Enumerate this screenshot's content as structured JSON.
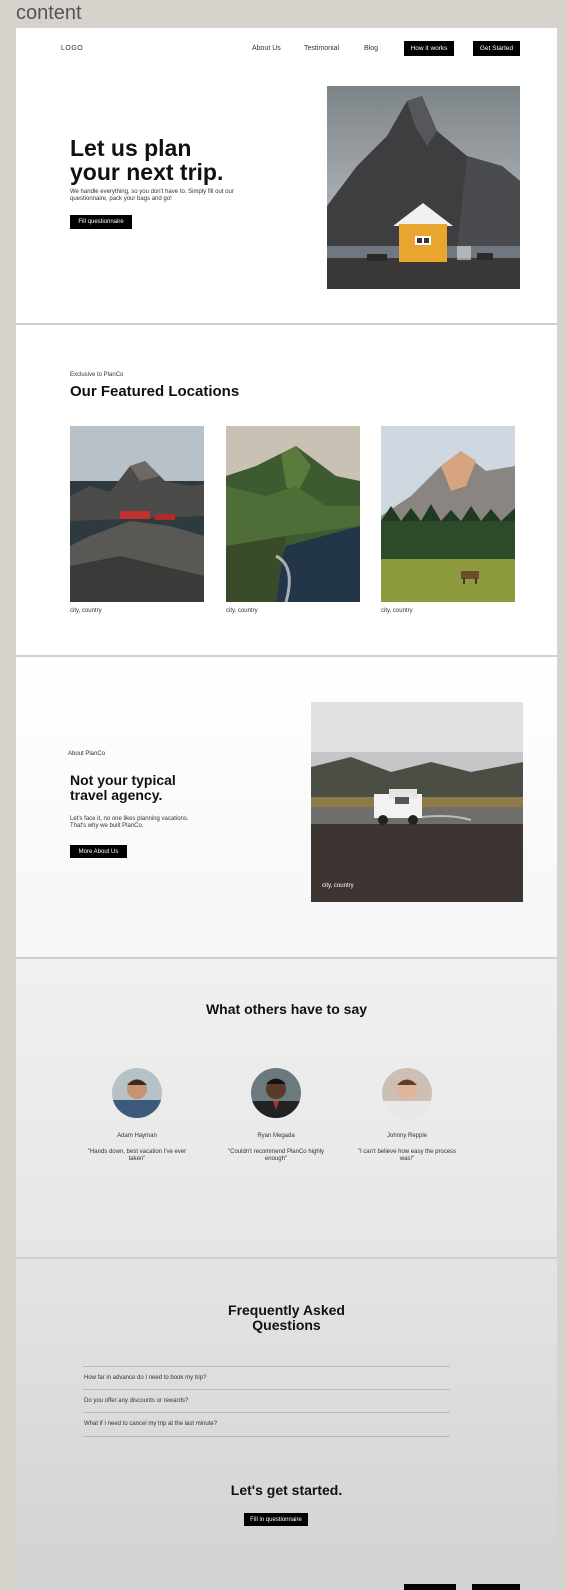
{
  "canvas": {
    "label": "content"
  },
  "nav": {
    "logo": "LOGO",
    "links": [
      "About Us",
      "Testimonial",
      "Blog"
    ],
    "how_it_works": "How it works",
    "get_started": "Get Started"
  },
  "hero": {
    "title_line1": "Let us plan",
    "title_line2": "your next trip.",
    "subtitle": "We handle everything, so you don't have to. Simply fill out our questionnaire, pack your bags and go!",
    "cta": "Fill questionnaire"
  },
  "featured": {
    "eyebrow": "Exclusive to PlanCo",
    "title": "Our Featured Locations",
    "locations": [
      {
        "caption": "city, country"
      },
      {
        "caption": "city, country"
      },
      {
        "caption": "city, country"
      }
    ]
  },
  "about": {
    "eyebrow": "About PlanCo",
    "title_line1": "Not your typical",
    "title_line2": "travel agency.",
    "body": "Let's face it, no one likes planning vacations. That's why we built PlanCo.",
    "cta": "More About Us",
    "image_caption": "city, country"
  },
  "testimonials": {
    "title": "What others have to say",
    "items": [
      {
        "name": "Adam Hayman",
        "quote": "\"Hands down, best vacation I've ever taken\""
      },
      {
        "name": "Ryan Megada",
        "quote": "\"Couldn't recommend PlanCo highly enough\""
      },
      {
        "name": "Johnny Repple",
        "quote": "\"I can't believe how easy the process was!\""
      }
    ]
  },
  "faq": {
    "title_line1": "Frequently Asked",
    "title_line2": "Questions",
    "questions": [
      "How far in advance do I need to book my trip?",
      "Do you offer any discounts or rewards?",
      "What if I need to cancel my trip at the last minute?"
    ]
  },
  "cta_section": {
    "title": "Let's get started.",
    "button": "Fill in questionnaire"
  },
  "colors": {
    "accent": "#000000",
    "frame_bg": "#ffffff",
    "canvas_bg": "#d6d2cc"
  }
}
